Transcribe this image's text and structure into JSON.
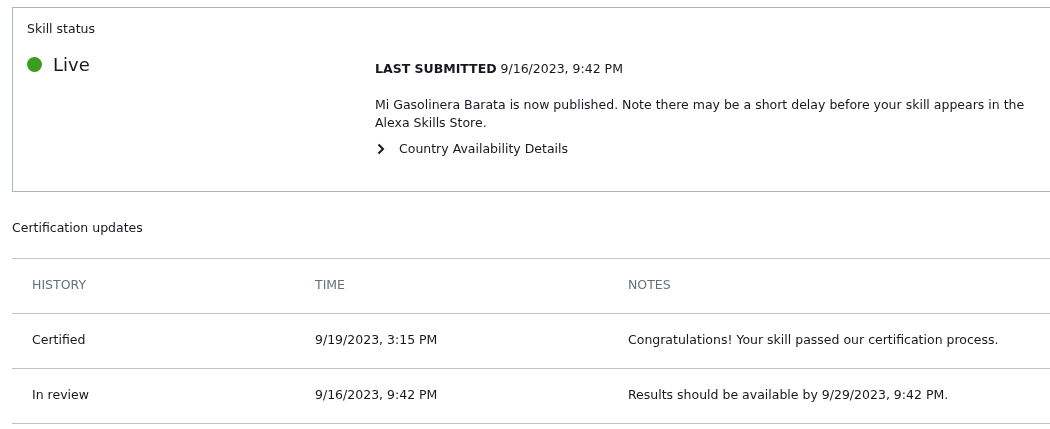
{
  "skill_status": {
    "title": "Skill status",
    "status": {
      "label": "Live",
      "color": "#3c9c1e"
    },
    "last_submitted": "**LAST SUBMITTED** 9/16/2023, 9:42 PM",
    "message": "Mi Gasolinera Barata is now published. Note there may be a short delay before your skill appears in the Alexa Skills Store.",
    "country_availability": {
      "label": "Country Availability Details",
      "expanded": false
    }
  },
  "certification_updates": {
    "title": "Certification updates",
    "table": {
      "columns": [
        "HISTORY",
        "TIME",
        "NOTES"
      ],
      "rows": [
        [
          "Certified",
          "9/19/2023, 3:15 PM",
          "Congratulations! Your skill passed our certification process."
        ],
        [
          "In review",
          "9/16/2023, 9:42 PM",
          "Results should be available by 9/29/2023, 9:42 PM."
        ]
      ]
    }
  }
}
